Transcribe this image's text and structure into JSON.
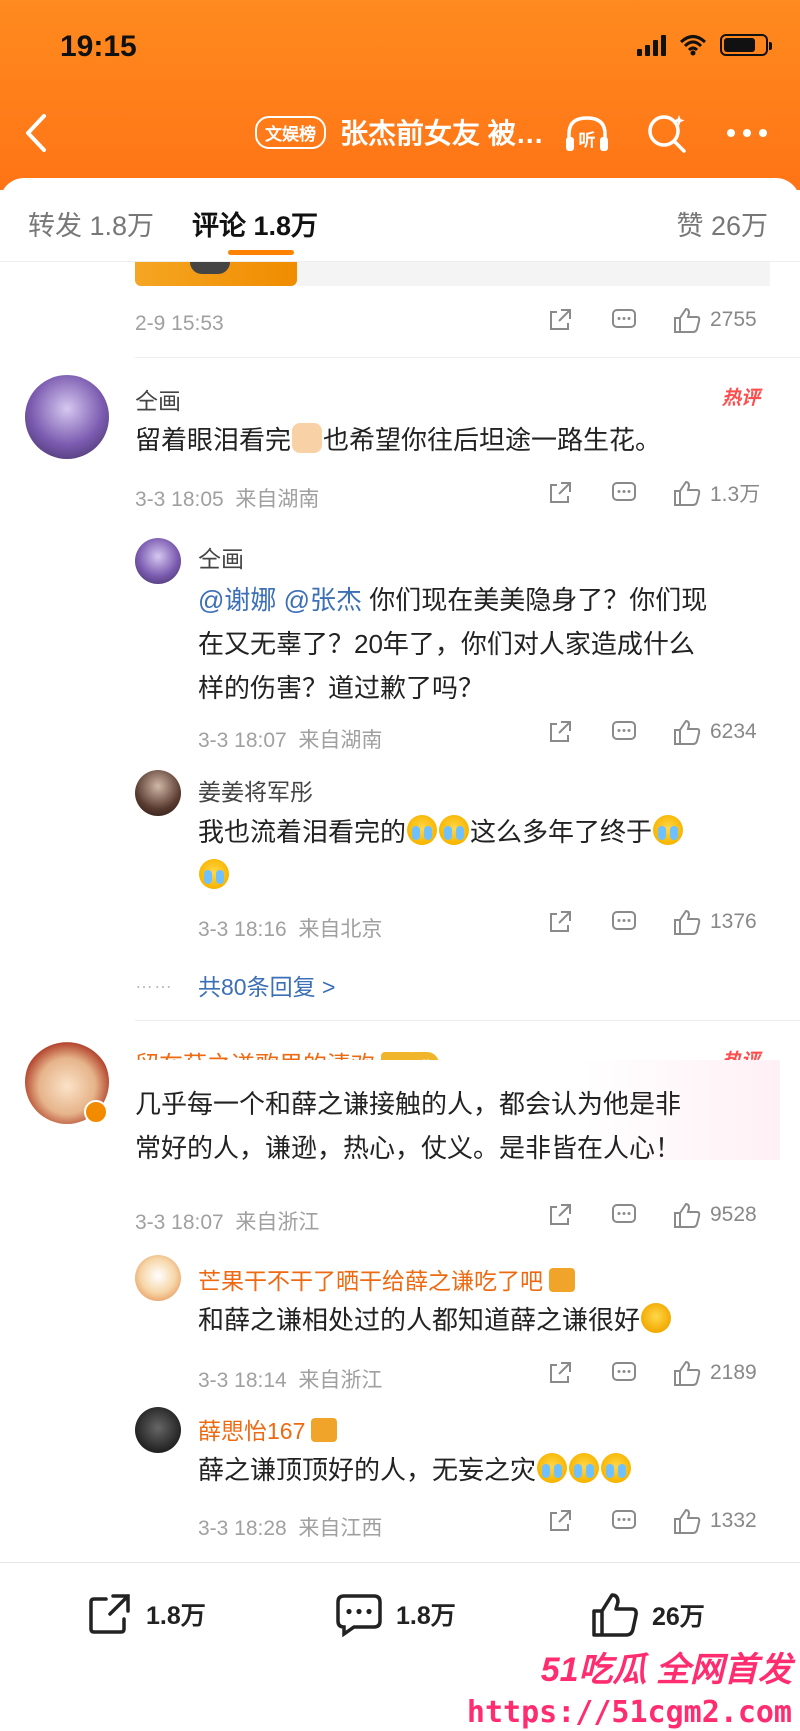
{
  "status_bar": {
    "time": "19:15"
  },
  "nav": {
    "tag": "文娱榜",
    "title": "张杰前女友 被…",
    "listen_label": "听"
  },
  "tabs": {
    "forward": "转发 1.8万",
    "comment": "评论 1.8万",
    "like": "赞 26万"
  },
  "top_post": {
    "time": "2-9 15:53",
    "likes": "2755"
  },
  "comments": [
    {
      "user": "仝画",
      "hot_label": "热评",
      "text": "留着眼泪看完",
      "text_after": "也希望你往后坦途一路生花。",
      "time": "3-3 18:05",
      "location": "来自湖南",
      "likes": "1.3万",
      "replies": [
        {
          "user": "仝画",
          "mention1": "@谢娜",
          "mention2": "@张杰",
          "text_l1": " 你们现在美美隐身了？你们现",
          "text_l2": "在又无辜了？20年了，你们对人家造成什么",
          "text_l3": "样的伤害？道过歉了吗？",
          "time": "3-3 18:07",
          "location": "来自湖南",
          "likes": "6234"
        },
        {
          "user": "姜姜将军彤",
          "text_l1": "我也流着泪看完的",
          "text_l1b": "这么多年了终于",
          "time": "3-3 18:16",
          "location": "来自北京",
          "likes": "1376"
        }
      ],
      "more_replies": "共80条回复 >",
      "dots": "……"
    },
    {
      "user": "留在薛之谦歌里的清欢",
      "hot_label": "热评",
      "text_l1": "几乎每一个和薛之谦接触的人，都会认为他是非",
      "text_l2": "常好的人，谦逊，热心，仗义。是非皆在人心！",
      "time": "3-3 18:07",
      "location": "来自浙江",
      "likes": "9528",
      "replies": [
        {
          "user": "芒果干不干了晒干给薛之谦吃了吧",
          "text": "和薛之谦相处过的人都知道薛之谦很好",
          "time": "3-3 18:14",
          "location": "来自浙江",
          "likes": "2189"
        },
        {
          "user": "薛愳怡167",
          "text": "薛之谦顶顶好的人，无妄之灾",
          "time": "3-3 18:28",
          "location": "来自江西",
          "likes": "1332"
        }
      ]
    }
  ],
  "bottom_bar": {
    "forward": "1.8万",
    "comment": "1.8万",
    "like": "26万"
  },
  "watermark": {
    "line1": "51吃瓜 全网首发",
    "line2": "https://51cgm2.com"
  },
  "colors": {
    "header": "#ff7f1a",
    "accent": "#ff8200",
    "link": "#3b6fb6",
    "hot": "#ff4c4c"
  }
}
